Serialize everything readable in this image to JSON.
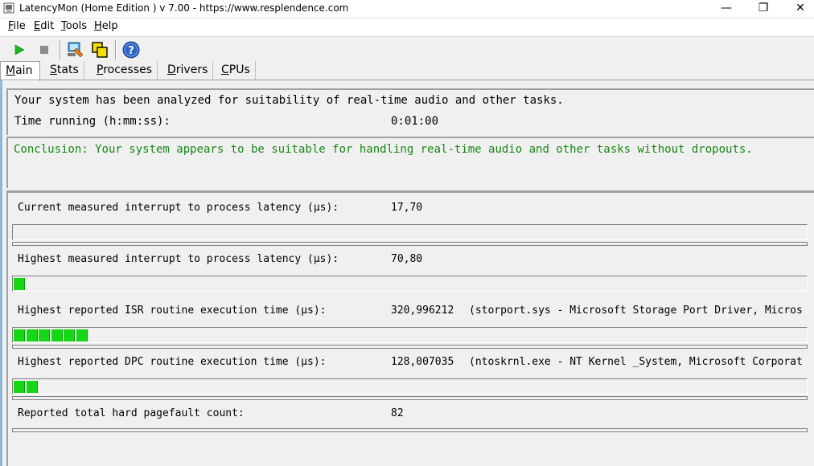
{
  "window": {
    "title": "LatencyMon  (Home Edition )  v 7.00 - https://www.resplendence.com",
    "min_glyph": "—",
    "max_glyph": "❐",
    "close_glyph": "✕"
  },
  "menu": [
    {
      "hot": "F",
      "rest": "ile"
    },
    {
      "hot": "E",
      "rest": "dit"
    },
    {
      "hot": "T",
      "rest": "ools"
    },
    {
      "hot": "H",
      "rest": "elp"
    }
  ],
  "toolbar": {
    "icons": [
      "start-monitoring-icon",
      "stop-monitoring-icon",
      "system-info-icon",
      "copy-icon",
      "help-icon"
    ]
  },
  "tabs": [
    {
      "hot": "M",
      "rest": "ain",
      "active": true
    },
    {
      "hot": "S",
      "rest": "tats",
      "active": false
    },
    {
      "hot": "P",
      "rest": "rocesses",
      "active": false
    },
    {
      "hot": "D",
      "rest": "rivers",
      "active": false
    },
    {
      "hot": "C",
      "rest": "PUs",
      "active": false
    }
  ],
  "summary": {
    "line1": "Your system has been analyzed for suitability of real-time audio and other tasks.",
    "time_label": "Time running (h:mm:ss):",
    "time_value": "0:01:00"
  },
  "conclusion": {
    "text": "Conclusion: Your system appears to be suitable for handling real-time audio and other tasks without dropouts.",
    "color": "#168816"
  },
  "metrics": [
    {
      "label": "Current measured interrupt to process latency (µs):",
      "value": "17,70",
      "detail": "",
      "segments": 0
    },
    {
      "label": "Highest measured interrupt to process latency (µs):",
      "value": "70,80",
      "detail": "",
      "segments": 1
    },
    {
      "label": "Highest reported ISR routine execution time (µs):",
      "value": "320,996212",
      "detail": "(storport.sys - Microsoft Storage Port Driver, Micros",
      "segments": 6
    },
    {
      "label": "Highest reported DPC routine execution time (µs):",
      "value": "128,007035",
      "detail": "(ntoskrnl.exe - NT Kernel _System, Microsoft Corporat",
      "segments": 2
    },
    {
      "label": "Reported total hard pagefault count:",
      "value": "82",
      "detail": "",
      "segments": null
    }
  ],
  "colors": {
    "meter_fill": "#14d814",
    "meter_edge": "#0a9a0a"
  }
}
